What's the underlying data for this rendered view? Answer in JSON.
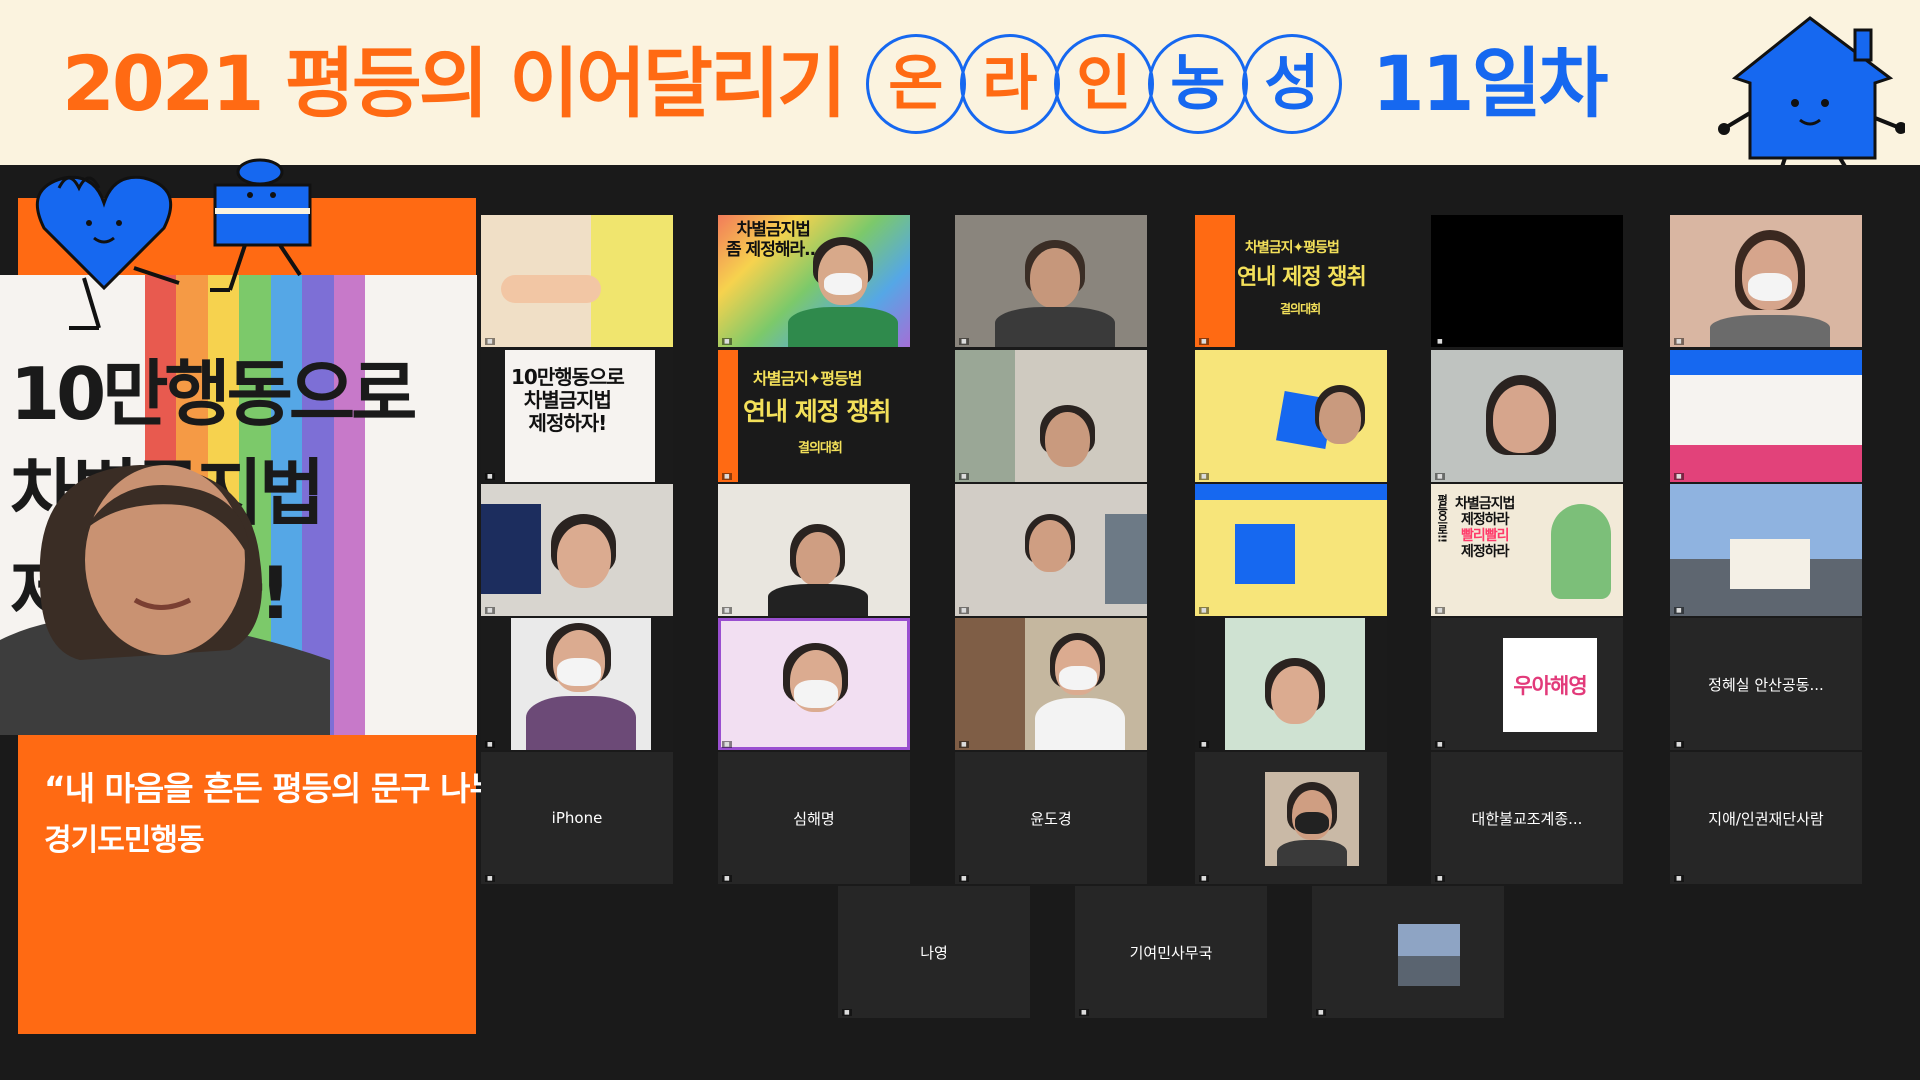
{
  "banner": {
    "title_part1": "2021 평등의 이어달리기",
    "circle_chars": [
      "온",
      "라",
      "인",
      "농",
      "성"
    ],
    "title_part2": "11일차"
  },
  "speaker": {
    "slogan_line1": "10만행동으로",
    "slogan_line2": "차별금지법",
    "slogan_line3": "제정하자!",
    "quote": "“내 마음을 흔든 평등의 문구 나누기 ”",
    "org": "경기도민행동"
  },
  "tiles": {
    "r1c2_poster_line1": "차별금지법",
    "r1c2_poster_line2": "좀 제정해라...",
    "r1c4_line1": "차별금지✦평등법",
    "r1c4_line2": "연내 제정 쟁취",
    "r1c4_line3": "결의대회",
    "r2c1_line1": "10만행동으로",
    "r2c1_line2": "차별금지법",
    "r2c1_line3": "제정하자!",
    "r2c2_line1": "차별금지✦평등법",
    "r2c2_line2": "연내 제정 쟁취",
    "r2c2_line3": "결의대회",
    "r3c5_line1": "차별금지법",
    "r3c5_line2": "제정하라",
    "r3c5_line3": "빨리빨리",
    "r3c5_line4": "제정하라",
    "r3c5_side": "평등으로!!",
    "r4c5_logo": "우아해영",
    "r4c6_name": "정혜실 안산공동...",
    "r5c1_name": "iPhone",
    "r5c2_name": "심해명",
    "r5c3_name": "윤도경",
    "r5c5_name": "대한불교조계종...",
    "r5c6_name": "지애/인권재단사람",
    "r6c1_name": "나영",
    "r6c2_name": "기여민사무국"
  },
  "colors": {
    "orange": "#ff6a13",
    "blue": "#1668f0",
    "banner_bg": "#fbf3df",
    "dark_bg": "#1a1a1a"
  }
}
